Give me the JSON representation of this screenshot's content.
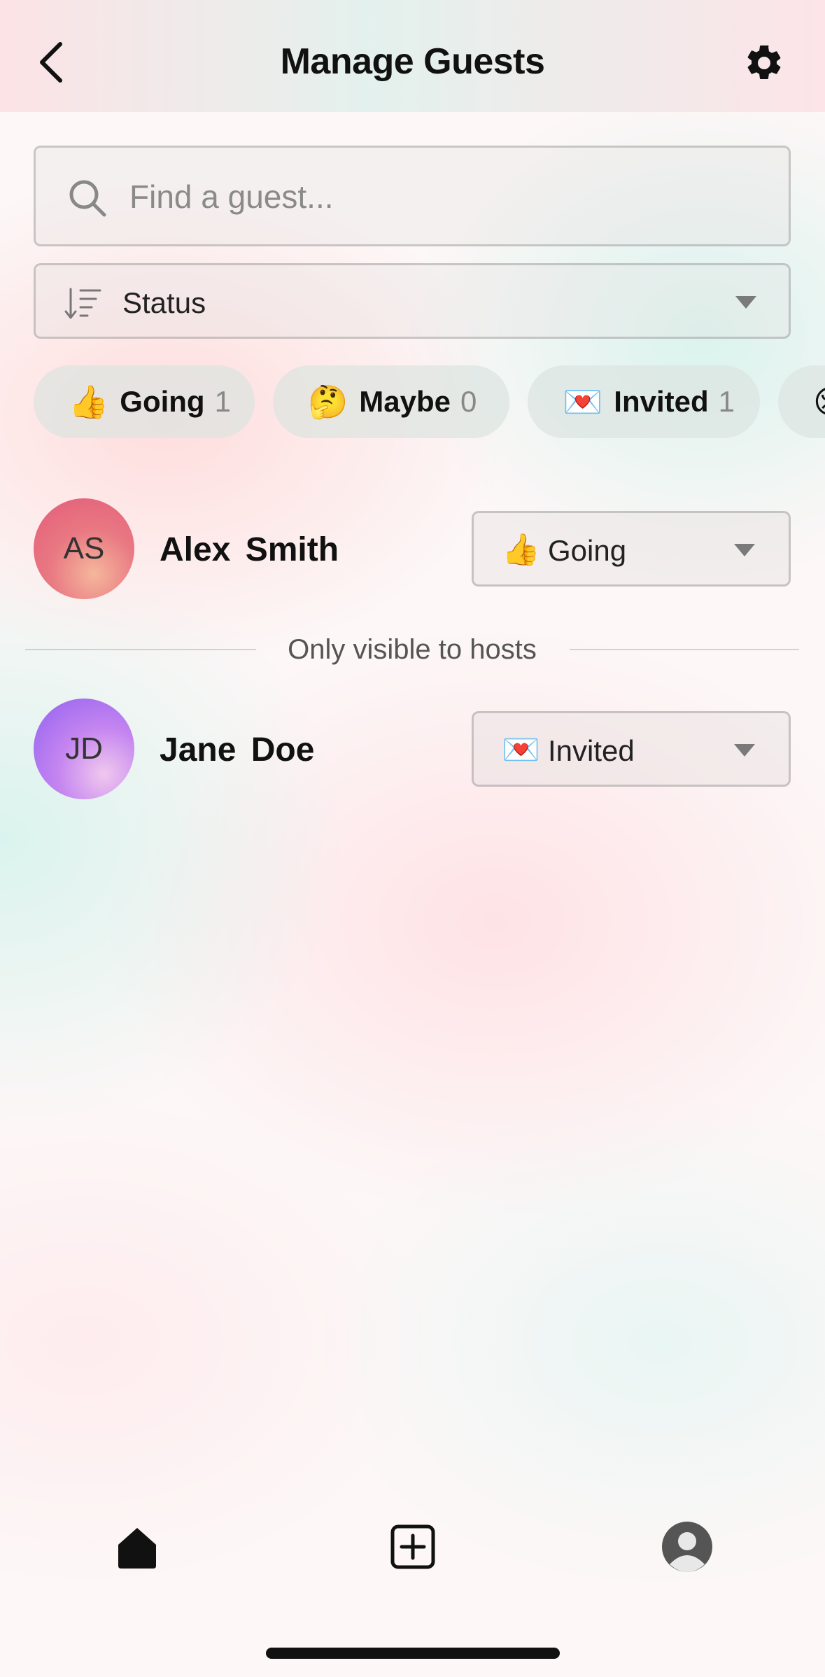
{
  "header": {
    "title": "Manage Guests",
    "back_icon": "chevron-left-icon",
    "settings_icon": "gear-icon"
  },
  "search": {
    "placeholder": "Find a guest...",
    "value": "",
    "icon": "search-icon"
  },
  "sort": {
    "label": "Status",
    "icon": "sort-descending-icon"
  },
  "filters": [
    {
      "emoji": "👍",
      "label": "Going",
      "count": "1"
    },
    {
      "emoji": "🤔",
      "label": "Maybe",
      "count": "0"
    },
    {
      "emoji": "💌",
      "label": "Invited",
      "count": "1"
    }
  ],
  "guests": [
    {
      "initials": "AS",
      "name": "Alex Smith",
      "status_emoji": "👍",
      "status": "Going"
    },
    {
      "initials": "JD",
      "name": "Jane Doe",
      "status_emoji": "💌",
      "status": "Invited"
    }
  ],
  "divider_text": "Only visible to hosts",
  "nav": {
    "home_icon": "home-icon",
    "create_icon": "add-square-icon",
    "profile_icon": "profile-avatar-icon"
  },
  "colors": {
    "text": "#111111",
    "muted": "#888888",
    "avatar_as": "#e35b78",
    "avatar_jd": "#9160f0"
  }
}
